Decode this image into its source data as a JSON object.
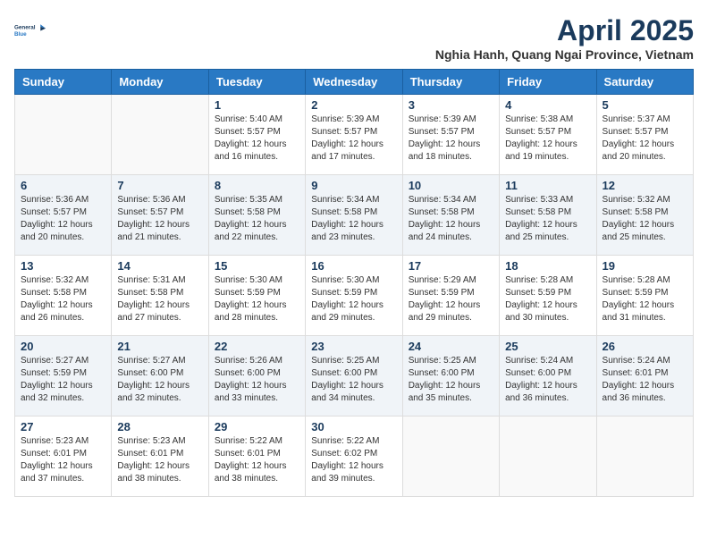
{
  "logo": {
    "line1": "General",
    "line2": "Blue"
  },
  "calendar_title": "April 2025",
  "subtitle": "Nghia Hanh, Quang Ngai Province, Vietnam",
  "headers": [
    "Sunday",
    "Monday",
    "Tuesday",
    "Wednesday",
    "Thursday",
    "Friday",
    "Saturday"
  ],
  "weeks": [
    [
      {
        "day": "",
        "info": ""
      },
      {
        "day": "",
        "info": ""
      },
      {
        "day": "1",
        "info": "Sunrise: 5:40 AM\nSunset: 5:57 PM\nDaylight: 12 hours\nand 16 minutes."
      },
      {
        "day": "2",
        "info": "Sunrise: 5:39 AM\nSunset: 5:57 PM\nDaylight: 12 hours\nand 17 minutes."
      },
      {
        "day": "3",
        "info": "Sunrise: 5:39 AM\nSunset: 5:57 PM\nDaylight: 12 hours\nand 18 minutes."
      },
      {
        "day": "4",
        "info": "Sunrise: 5:38 AM\nSunset: 5:57 PM\nDaylight: 12 hours\nand 19 minutes."
      },
      {
        "day": "5",
        "info": "Sunrise: 5:37 AM\nSunset: 5:57 PM\nDaylight: 12 hours\nand 20 minutes."
      }
    ],
    [
      {
        "day": "6",
        "info": "Sunrise: 5:36 AM\nSunset: 5:57 PM\nDaylight: 12 hours\nand 20 minutes."
      },
      {
        "day": "7",
        "info": "Sunrise: 5:36 AM\nSunset: 5:57 PM\nDaylight: 12 hours\nand 21 minutes."
      },
      {
        "day": "8",
        "info": "Sunrise: 5:35 AM\nSunset: 5:58 PM\nDaylight: 12 hours\nand 22 minutes."
      },
      {
        "day": "9",
        "info": "Sunrise: 5:34 AM\nSunset: 5:58 PM\nDaylight: 12 hours\nand 23 minutes."
      },
      {
        "day": "10",
        "info": "Sunrise: 5:34 AM\nSunset: 5:58 PM\nDaylight: 12 hours\nand 24 minutes."
      },
      {
        "day": "11",
        "info": "Sunrise: 5:33 AM\nSunset: 5:58 PM\nDaylight: 12 hours\nand 25 minutes."
      },
      {
        "day": "12",
        "info": "Sunrise: 5:32 AM\nSunset: 5:58 PM\nDaylight: 12 hours\nand 25 minutes."
      }
    ],
    [
      {
        "day": "13",
        "info": "Sunrise: 5:32 AM\nSunset: 5:58 PM\nDaylight: 12 hours\nand 26 minutes."
      },
      {
        "day": "14",
        "info": "Sunrise: 5:31 AM\nSunset: 5:58 PM\nDaylight: 12 hours\nand 27 minutes."
      },
      {
        "day": "15",
        "info": "Sunrise: 5:30 AM\nSunset: 5:59 PM\nDaylight: 12 hours\nand 28 minutes."
      },
      {
        "day": "16",
        "info": "Sunrise: 5:30 AM\nSunset: 5:59 PM\nDaylight: 12 hours\nand 29 minutes."
      },
      {
        "day": "17",
        "info": "Sunrise: 5:29 AM\nSunset: 5:59 PM\nDaylight: 12 hours\nand 29 minutes."
      },
      {
        "day": "18",
        "info": "Sunrise: 5:28 AM\nSunset: 5:59 PM\nDaylight: 12 hours\nand 30 minutes."
      },
      {
        "day": "19",
        "info": "Sunrise: 5:28 AM\nSunset: 5:59 PM\nDaylight: 12 hours\nand 31 minutes."
      }
    ],
    [
      {
        "day": "20",
        "info": "Sunrise: 5:27 AM\nSunset: 5:59 PM\nDaylight: 12 hours\nand 32 minutes."
      },
      {
        "day": "21",
        "info": "Sunrise: 5:27 AM\nSunset: 6:00 PM\nDaylight: 12 hours\nand 32 minutes."
      },
      {
        "day": "22",
        "info": "Sunrise: 5:26 AM\nSunset: 6:00 PM\nDaylight: 12 hours\nand 33 minutes."
      },
      {
        "day": "23",
        "info": "Sunrise: 5:25 AM\nSunset: 6:00 PM\nDaylight: 12 hours\nand 34 minutes."
      },
      {
        "day": "24",
        "info": "Sunrise: 5:25 AM\nSunset: 6:00 PM\nDaylight: 12 hours\nand 35 minutes."
      },
      {
        "day": "25",
        "info": "Sunrise: 5:24 AM\nSunset: 6:00 PM\nDaylight: 12 hours\nand 36 minutes."
      },
      {
        "day": "26",
        "info": "Sunrise: 5:24 AM\nSunset: 6:01 PM\nDaylight: 12 hours\nand 36 minutes."
      }
    ],
    [
      {
        "day": "27",
        "info": "Sunrise: 5:23 AM\nSunset: 6:01 PM\nDaylight: 12 hours\nand 37 minutes."
      },
      {
        "day": "28",
        "info": "Sunrise: 5:23 AM\nSunset: 6:01 PM\nDaylight: 12 hours\nand 38 minutes."
      },
      {
        "day": "29",
        "info": "Sunrise: 5:22 AM\nSunset: 6:01 PM\nDaylight: 12 hours\nand 38 minutes."
      },
      {
        "day": "30",
        "info": "Sunrise: 5:22 AM\nSunset: 6:02 PM\nDaylight: 12 hours\nand 39 minutes."
      },
      {
        "day": "",
        "info": ""
      },
      {
        "day": "",
        "info": ""
      },
      {
        "day": "",
        "info": ""
      }
    ]
  ]
}
